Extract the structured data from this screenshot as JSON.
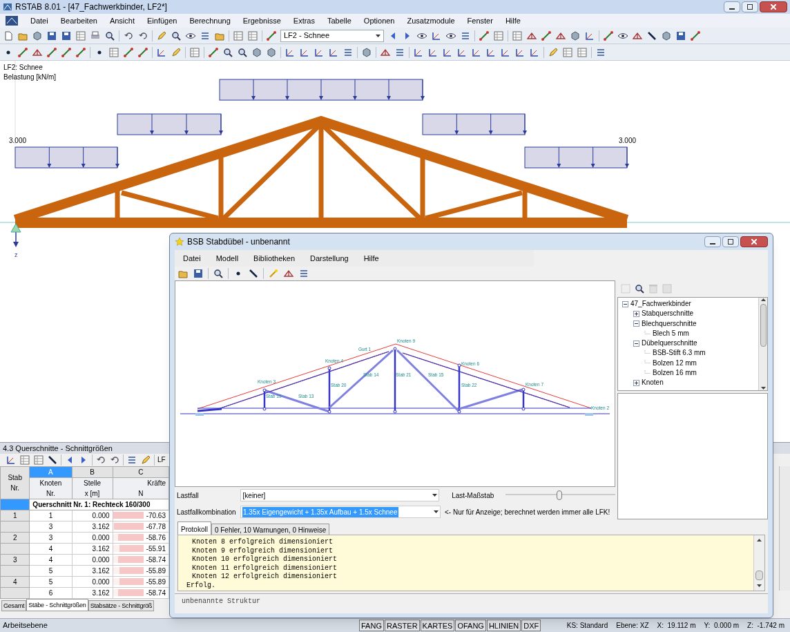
{
  "window": {
    "title": "RSTAB 8.01 - [47_Fachwerkbinder, LF2*]"
  },
  "menu": [
    "Datei",
    "Bearbeiten",
    "Ansicht",
    "Einfügen",
    "Berechnung",
    "Ergebnisse",
    "Extras",
    "Tabelle",
    "Optionen",
    "Zusatzmodule",
    "Fenster",
    "Hilfe"
  ],
  "toolbar": {
    "load_case": "LF2 - Schnee"
  },
  "canvas": {
    "load_case": "LF2: Schnee",
    "unit_label": "Belastung [kN/m]",
    "load_values": [
      "3.000",
      "3.000"
    ],
    "axis_label": "z"
  },
  "table_panel": {
    "title": "4.3 Querschnitte - Schnittgrößen",
    "toolbar_cut_label": "LF",
    "columns": [
      {
        "lines": [
          "Stab",
          "Nr."
        ],
        "selected": false
      },
      {
        "letter": "A",
        "lines": [
          "Knoten",
          "Nr."
        ],
        "selected": true
      },
      {
        "letter": "B",
        "lines": [
          "Stelle",
          "x [m]"
        ],
        "selected": false
      },
      {
        "letter": "C",
        "lines": [
          "Kräfte",
          "N"
        ],
        "selected": false
      }
    ],
    "group_row": {
      "text": "Querschnitt Nr. 1: Rechteck 160/300",
      "selected": true
    },
    "rows": [
      {
        "stab": "1",
        "knoten": "1",
        "stelle": "0.000",
        "n": "-70.63",
        "level": 1
      },
      {
        "stab": "",
        "knoten": "3",
        "stelle": "3.162",
        "n": "-67.78",
        "level": 0.96
      },
      {
        "stab": "2",
        "knoten": "3",
        "stelle": "0.000",
        "n": "-58.76",
        "level": 0.83
      },
      {
        "stab": "",
        "knoten": "4",
        "stelle": "3.162",
        "n": "-55.91",
        "level": 0.79
      },
      {
        "stab": "3",
        "knoten": "4",
        "stelle": "0.000",
        "n": "-58.74",
        "level": 0.83
      },
      {
        "stab": "",
        "knoten": "5",
        "stelle": "3.162",
        "n": "-55.89",
        "level": 0.79
      },
      {
        "stab": "4",
        "knoten": "5",
        "stelle": "0.000",
        "n": "-55.89",
        "level": 0.79
      },
      {
        "stab": "",
        "knoten": "6",
        "stelle": "3.162",
        "n": "-58.74",
        "level": 0.83
      }
    ],
    "tabs": [
      {
        "label": "Gesamt",
        "selected": false
      },
      {
        "label": "Stäbe - Schnittgrößen",
        "selected": true
      },
      {
        "label": "Stabsätze - Schnittgröß",
        "selected": false
      }
    ]
  },
  "dialog": {
    "title": "BSB Stabdübel - unbenannt",
    "menu": [
      "Datei",
      "Modell",
      "Bibliotheken",
      "Darstellung",
      "Hilfe"
    ],
    "drawing_labels": [
      "Knoten 9",
      "Gurt 1",
      "Knoten 4",
      "Knoten 3",
      "Knoten 6",
      "Knoten 7",
      "Knoten 2",
      "Stab 20",
      "Stab 14",
      "Stab 21",
      "Stab 15",
      "Stab 22",
      "Stab 19",
      "Stab 13"
    ],
    "tree": [
      {
        "label": "47_Fachwerkbinder",
        "expanded": true,
        "children": [
          {
            "label": "Stabquerschnitte",
            "expanded": false
          },
          {
            "label": "Blechquerschnitte",
            "expanded": true,
            "children": [
              {
                "label": "Blech 5 mm"
              }
            ]
          },
          {
            "label": "Dübelquerschnitte",
            "expanded": true,
            "children": [
              {
                "label": "BSB-Stift 6.3 mm"
              },
              {
                "label": "Bolzen 12 mm"
              },
              {
                "label": "Bolzen 16 mm"
              }
            ]
          },
          {
            "label": "Knoten",
            "expanded": false
          }
        ]
      }
    ],
    "fields": [
      {
        "label": "Lastfall",
        "value": "[keiner]",
        "highlighted": false
      },
      {
        "label": "Lastfallkombination",
        "value": "1.35x Eigengewicht + 1.35x Aufbau + 1.5x Schnee",
        "highlighted": true
      }
    ],
    "note": "<- Nur für Anzeige; berechnet werden immer alle LFK!",
    "scale": {
      "label": "Last-Maßstab",
      "level": 0.49
    },
    "tabs": [
      {
        "label": "Protokoll",
        "selected": true
      },
      {
        "label": "0 Fehler, 10 Warnungen, 0 Hinweise",
        "selected": false
      }
    ],
    "log": [
      {
        "kind": "detail",
        "text": "Knoten 8 erfolgreich dimensioniert"
      },
      {
        "kind": "detail",
        "text": "Knoten 9 erfolgreich dimensioniert"
      },
      {
        "kind": "detail",
        "text": "Knoten 10 erfolgreich dimensioniert"
      },
      {
        "kind": "detail",
        "text": "Knoten 11 erfolgreich dimensioniert"
      },
      {
        "kind": "detail",
        "text": "Knoten 12 erfolgreich dimensioniert"
      },
      {
        "kind": "summary",
        "text": "Erfolg."
      }
    ],
    "status": "unbenannte Struktur"
  },
  "status_bar": {
    "left": "Arbeitsebene",
    "toggles": [
      "FANG",
      "RASTER",
      "KARTES",
      "OFANG",
      "HLINIEN",
      "DXF"
    ],
    "fields": [
      "KS: Standard",
      "Ebene: XZ",
      "X:  19.112 m",
      "Y:  0.000 m",
      "Z:  -1.742 m"
    ]
  }
}
